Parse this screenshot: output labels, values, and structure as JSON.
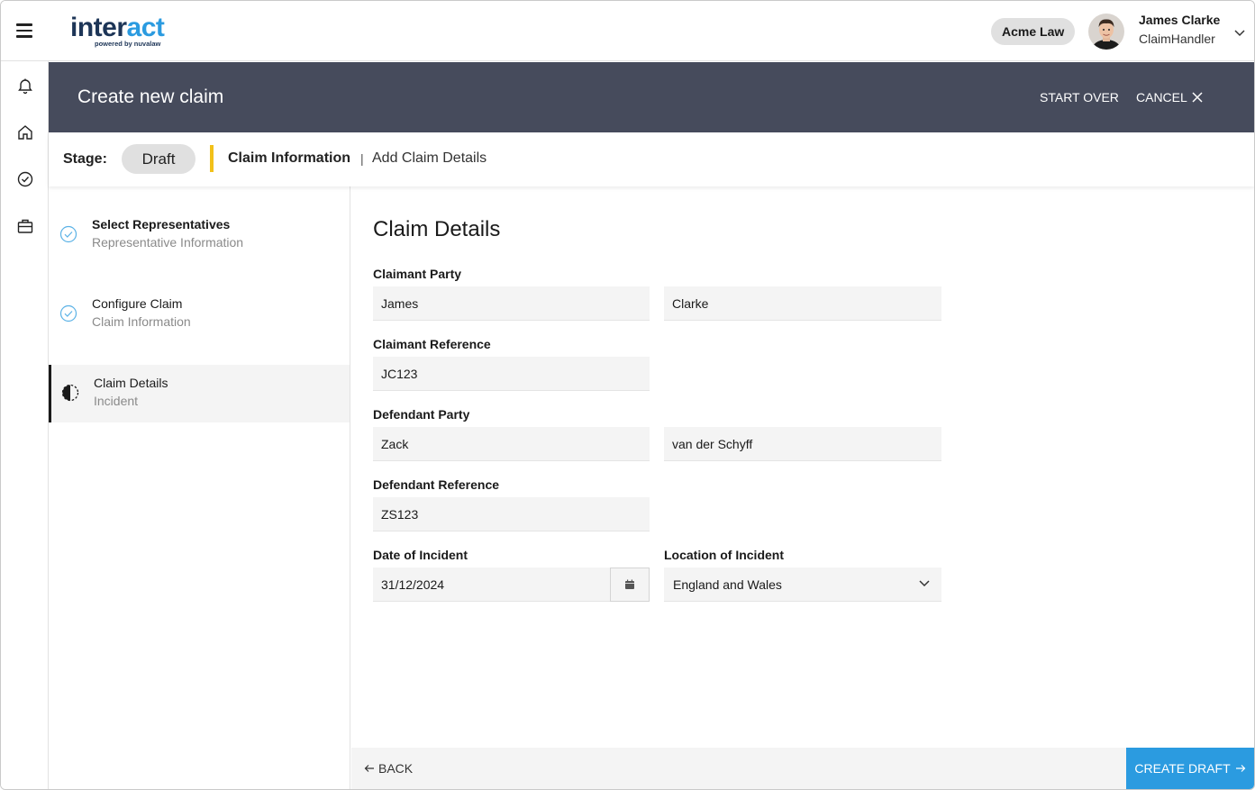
{
  "app": {
    "logo_main_dark": "inter",
    "logo_main_light": "act",
    "logo_sub": "powered by nuvalaw"
  },
  "topbar": {
    "org": "Acme Law",
    "user_name": "James Clarke",
    "user_role": "ClaimHandler"
  },
  "header": {
    "title": "Create new claim",
    "start_over": "START OVER",
    "cancel": "CANCEL"
  },
  "stage": {
    "label": "Stage:",
    "value": "Draft",
    "section": "Claim Information",
    "separator": "|",
    "subsection": "Add Claim Details"
  },
  "steps": [
    {
      "title": "Select Representatives",
      "subtitle": "Representative Information",
      "state": "complete"
    },
    {
      "title": "Configure Claim",
      "subtitle": "Claim Information",
      "state": "complete"
    },
    {
      "title": "Claim Details",
      "subtitle": "Incident",
      "state": "in-progress"
    }
  ],
  "form": {
    "title": "Claim Details",
    "claimant_party": {
      "label": "Claimant Party",
      "first": "James",
      "last": "Clarke"
    },
    "claimant_reference": {
      "label": "Claimant Reference",
      "value": "JC123"
    },
    "defendant_party": {
      "label": "Defendant Party",
      "first": "Zack",
      "last": "van der Schyff"
    },
    "defendant_reference": {
      "label": "Defendant Reference",
      "value": "ZS123"
    },
    "date_of_incident": {
      "label": "Date of Incident",
      "value": "31/12/2024"
    },
    "location_of_incident": {
      "label": "Location of Incident",
      "value": "England and Wales"
    }
  },
  "footer": {
    "back": "BACK",
    "create": "CREATE DRAFT"
  },
  "colors": {
    "accent": "#2b9be0",
    "header_bg": "#464b5c",
    "stage_divider": "#f2c11a",
    "logo_dark": "#1d3557"
  },
  "icons": {
    "rail": [
      "bell-icon",
      "home-icon",
      "check-circle-icon",
      "briefcase-icon"
    ]
  }
}
